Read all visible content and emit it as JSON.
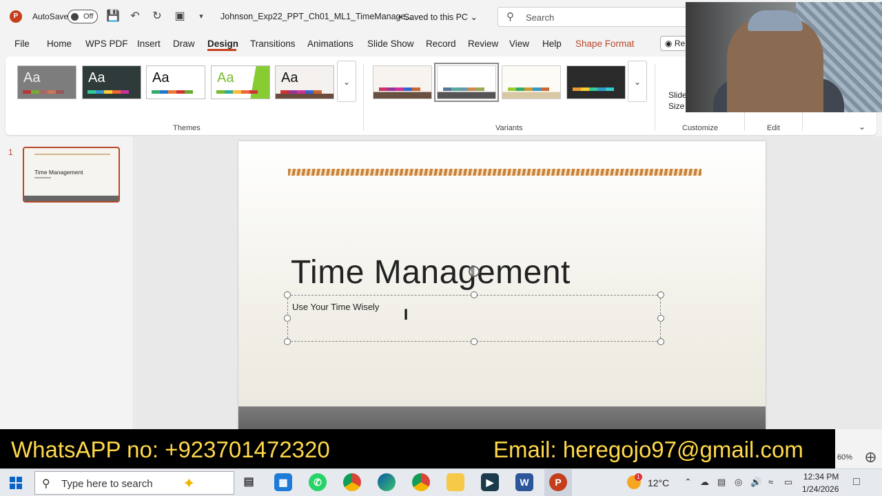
{
  "titlebar": {
    "app_icon": "P",
    "autosave_label": "AutoSave",
    "autosave_state": "Off",
    "filename": "Johnson_Exp22_PPT_Ch01_ML1_TimeManage...",
    "saved_state": "• Saved to this PC",
    "search_placeholder": "Search"
  },
  "menu": {
    "tabs": [
      "File",
      "Home",
      "WPS PDF",
      "Insert",
      "Draw",
      "Design",
      "Transitions",
      "Animations",
      "Slide Show",
      "Record",
      "Review",
      "View",
      "Help",
      "Shape Format"
    ],
    "active": "Design",
    "record_label": "Re"
  },
  "ribbon": {
    "themes_label": "Themes",
    "variants_label": "Variants",
    "customize_label": "Customize",
    "edit_label": "Edit",
    "slide_size_label1": "Slide",
    "slide_size_label2": "Size",
    "theme_aa": "Aa"
  },
  "thumbnail": {
    "number": "1",
    "title": "Time Management"
  },
  "slide": {
    "title": "Time Management",
    "subtitle": "Use Your Time Wisely"
  },
  "banner": {
    "whatsapp": "WhatsAPP no: +923701472320",
    "email": "Email: heregojo97@gmail.com"
  },
  "status": {
    "zoom": "60%"
  },
  "taskbar": {
    "search_placeholder": "Type here to search",
    "weather_badge": "1",
    "temperature": "12°C",
    "time": "12:34 PM",
    "date": "1/24/2026"
  },
  "colors": {
    "accent": "#c43e1c",
    "banner_text": "#ffd94a"
  }
}
